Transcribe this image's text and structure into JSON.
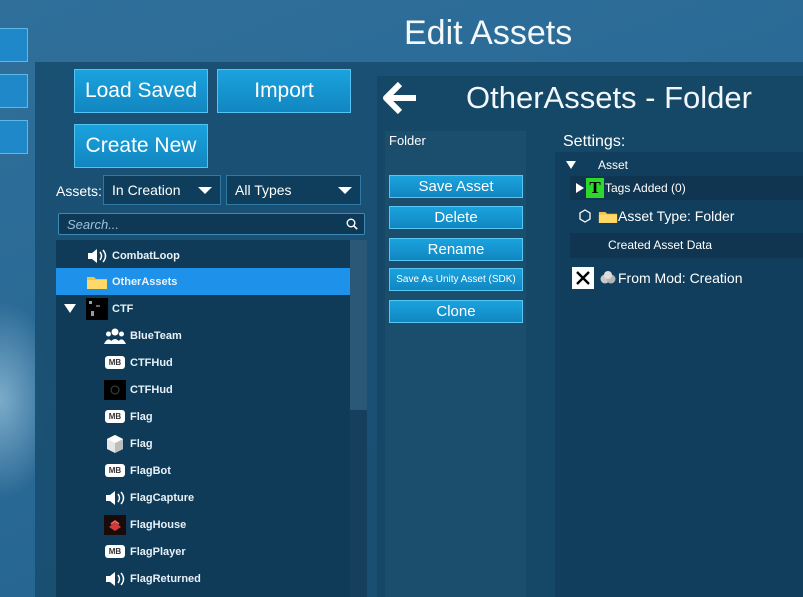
{
  "page_title": "Edit Assets",
  "buttons": {
    "load_saved": "Load Saved",
    "import": "Import",
    "create_new": "Create New"
  },
  "filters": {
    "label": "Assets:",
    "status": "In Creation",
    "type": "All Types"
  },
  "search": {
    "placeholder": "Search..."
  },
  "tree": [
    {
      "label": "CombatLoop",
      "icon": "speaker-icon"
    },
    {
      "label": "OtherAssets",
      "icon": "folder-icon",
      "selected": true
    },
    {
      "label": "CTF",
      "icon": "ctf-icon",
      "expanded": true
    },
    {
      "label": "BlueTeam",
      "icon": "team-icon"
    },
    {
      "label": "CTFHud",
      "icon": "mb-icon"
    },
    {
      "label": "CTFHud",
      "icon": "hud-image-icon"
    },
    {
      "label": "Flag",
      "icon": "mb-icon"
    },
    {
      "label": "Flag",
      "icon": "cube-icon"
    },
    {
      "label": "FlagBot",
      "icon": "mb-icon"
    },
    {
      "label": "FlagCapture",
      "icon": "speaker-icon"
    },
    {
      "label": "FlagHouse",
      "icon": "house-image-icon"
    },
    {
      "label": "FlagPlayer",
      "icon": "mb-icon"
    },
    {
      "label": "FlagReturned",
      "icon": "speaker-icon"
    }
  ],
  "mb_badge": "MB",
  "detail": {
    "title": "OtherAssets - Folder",
    "type_header": "Folder",
    "actions": {
      "save": "Save Asset",
      "delete": "Delete",
      "rename": "Rename",
      "save_unity": "Save As Unity Asset (SDK)",
      "clone": "Clone"
    },
    "settings_label": "Settings:",
    "settings": {
      "asset_header": "Asset",
      "tags_added": "Tags Added (0)",
      "tags_icon_letter": "T",
      "asset_type": "Asset Type: Folder",
      "created_data": "Created Asset Data",
      "from_mod": "From Mod: Creation"
    }
  },
  "colors": {
    "accent_button": "#1aa3de",
    "selected_row": "#1e92ea",
    "panel": "#154766"
  }
}
